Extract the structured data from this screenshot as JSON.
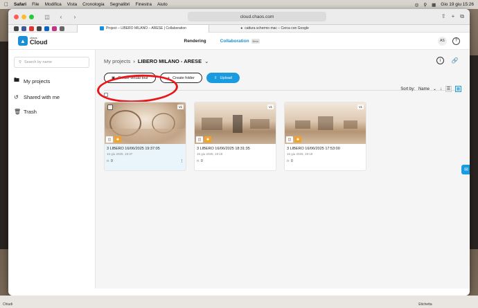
{
  "menubar": {
    "app": "Safari",
    "items": [
      "File",
      "Modifica",
      "Vista",
      "Cronologia",
      "Segnalibri",
      "Finestra",
      "Aiuto"
    ],
    "datetime": "Gio 19 giu  15:26"
  },
  "browser": {
    "address": "cloud.chaos.com",
    "tabs": [
      {
        "label": "Project – LIBERO MILANO – ARESE | Collaboration",
        "active": true
      },
      {
        "label": "cattura schermo mac – Cerca con Google",
        "active": false
      }
    ]
  },
  "header": {
    "logo_small": "chaos",
    "logo_big": "Cloud",
    "nav_rendering": "Rendering",
    "nav_collaboration": "Collaboration",
    "beta": "Beta",
    "avatar": "AS",
    "help": "?"
  },
  "sidebar": {
    "search_placeholder": "Search by name",
    "items": [
      {
        "label": "My projects",
        "icon": "folder-icon"
      },
      {
        "label": "Shared with me",
        "icon": "share-icon"
      },
      {
        "label": "Trash",
        "icon": "trash-icon"
      }
    ]
  },
  "main": {
    "breadcrumb_root": "My projects",
    "breadcrumb_current": "LIBERO MILANO - ARESE",
    "create_tour": "Create virtual tour",
    "create_folder": "Create folder",
    "upload": "Upload",
    "sort_label": "Sort by:",
    "sort_value": "Name"
  },
  "cards": [
    {
      "title": "3 LIBERO 16/06/2025 19:37:05",
      "date": "16 giu 2025, 19:37",
      "comments": "0",
      "version": "v1",
      "selected": true
    },
    {
      "title": "3 LIBERO 16/06/2025 18:31:35",
      "date": "16 giu 2025, 19:19",
      "comments": "0",
      "version": "v1",
      "selected": false
    },
    {
      "title": "3 LIBERO 16/06/2025 17:53:00",
      "date": "16 giu 2025, 19:19",
      "comments": "0",
      "version": "v1",
      "selected": false
    }
  ],
  "statusbar": {
    "left": "Chiudi",
    "right": "Etichetta"
  },
  "colors": {
    "accent": "#1a9be0",
    "annotation": "#e8161a",
    "badge": "#f0a32a"
  }
}
